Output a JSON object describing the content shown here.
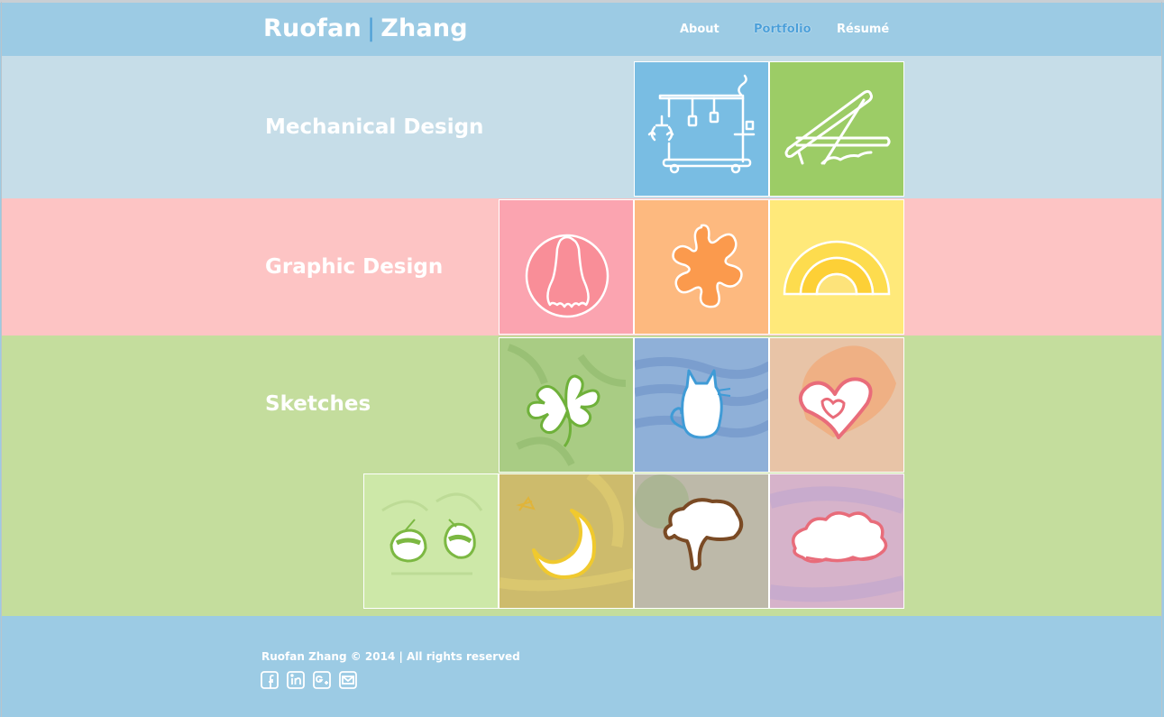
{
  "header": {
    "logo_first": "Ruofan",
    "logo_sep": "|",
    "logo_last": "Zhang",
    "nav": [
      "About",
      "Portfolio",
      "Résumé"
    ]
  },
  "sections": {
    "mechanical": "Mechanical Design",
    "graphic": "Graphic Design",
    "sketches": "Sketches"
  },
  "tiles": {
    "mechanical": [
      "gantry-robot-icon",
      "lever-icon"
    ],
    "graphic": [
      "bell-icon",
      "splash-icon",
      "rainbow-icon"
    ],
    "sketches": [
      "clover-icon",
      "cat-icon",
      "heart-icon",
      "eyes-icon",
      "moon-icon",
      "tree-icon",
      "cloud-icon"
    ]
  },
  "colors": {
    "header": "#9ccbe4",
    "mechanical_band": "#c6dde8",
    "graphic_band": "#fdc4c4",
    "sketch_band": "#c4dd9d",
    "accent": "#4a9fd9"
  },
  "footer": {
    "copyright": "Ruofan Zhang © 2014 | All rights reserved",
    "social": [
      "facebook-icon",
      "linkedin-icon",
      "google-plus-icon",
      "email-icon"
    ]
  }
}
